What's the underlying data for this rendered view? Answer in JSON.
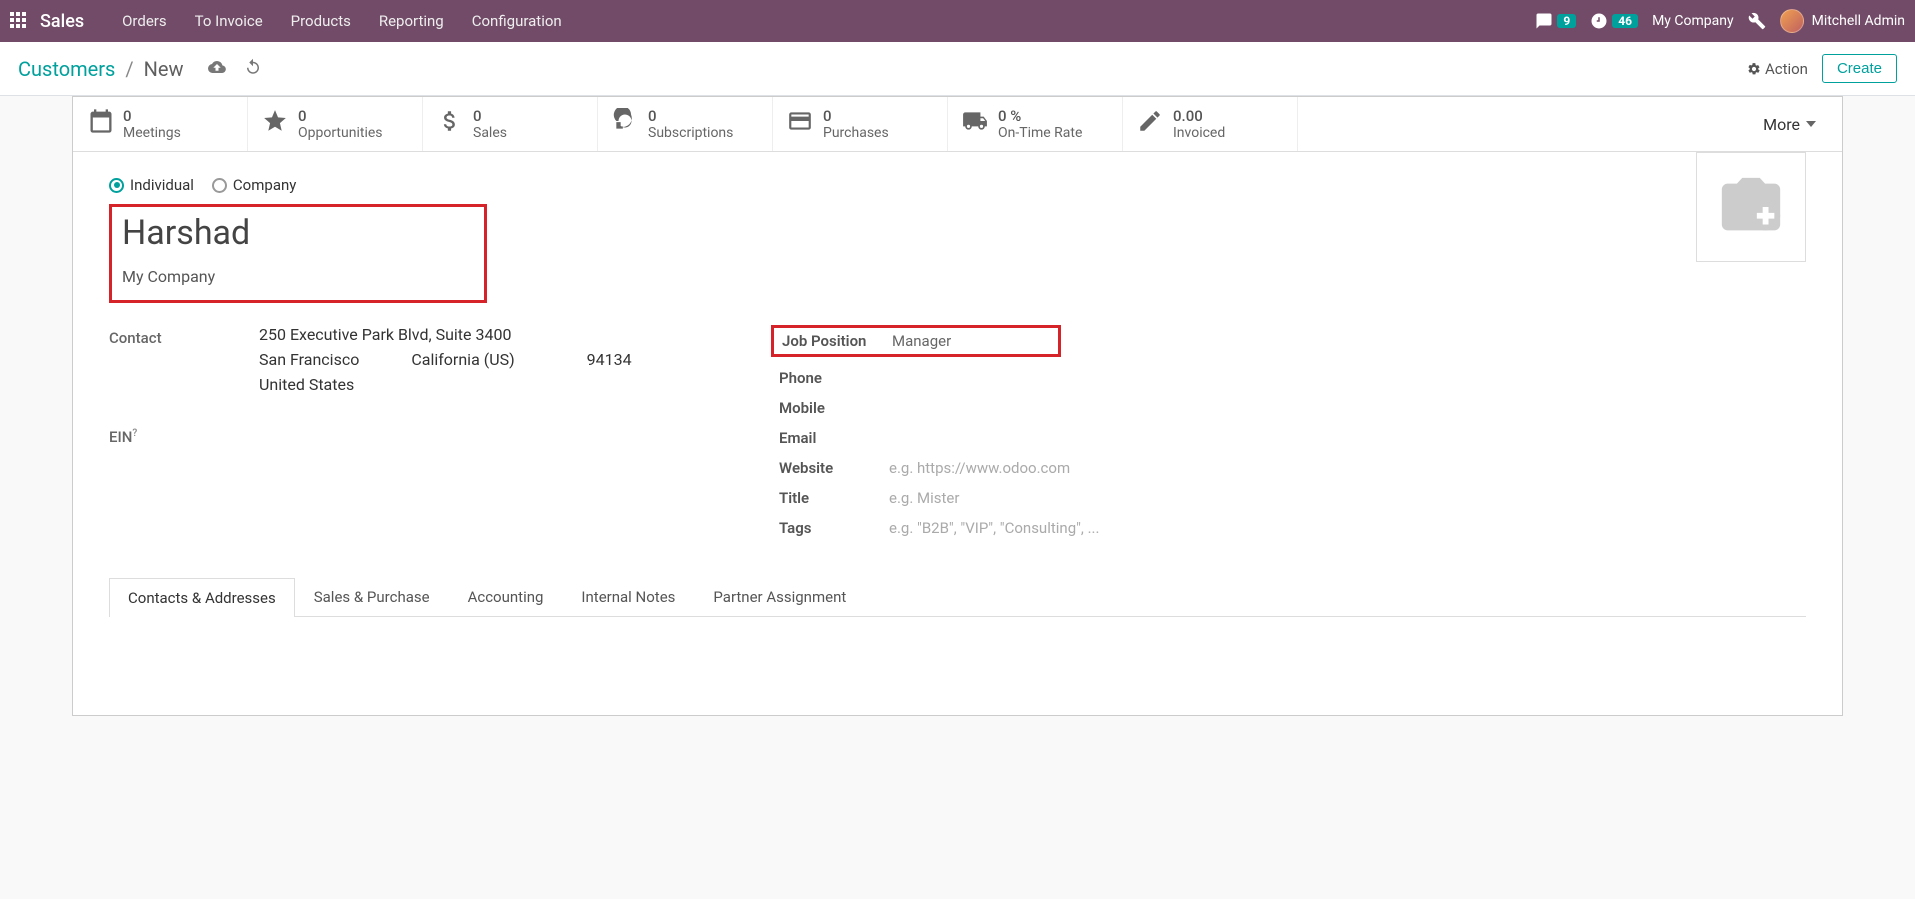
{
  "topbar": {
    "app": "Sales",
    "menu": [
      "Orders",
      "To Invoice",
      "Products",
      "Reporting",
      "Configuration"
    ],
    "msg_count": "9",
    "activity_count": "46",
    "company": "My Company",
    "user": "Mitchell Admin"
  },
  "breadcrumb": {
    "root": "Customers",
    "current": "New"
  },
  "controls": {
    "action": "Action",
    "create": "Create"
  },
  "stats": [
    {
      "value": "0",
      "label": "Meetings",
      "icon": "calendar"
    },
    {
      "value": "0",
      "label": "Opportunities",
      "icon": "star"
    },
    {
      "value": "0",
      "label": "Sales",
      "icon": "dollar"
    },
    {
      "value": "0",
      "label": "Subscriptions",
      "icon": "refresh"
    },
    {
      "value": "0",
      "label": "Purchases",
      "icon": "card"
    },
    {
      "value": "0 %",
      "label": "On-Time Rate",
      "icon": "truck"
    },
    {
      "value": "0.00",
      "label": "Invoiced",
      "icon": "edit"
    }
  ],
  "more": "More",
  "type_radio": {
    "individual": "Individual",
    "company": "Company"
  },
  "record": {
    "name": "Harshad",
    "company": "My Company"
  },
  "contact": {
    "label": "Contact",
    "street": "250 Executive Park Blvd, Suite 3400",
    "city": "San Francisco",
    "state": "California (US)",
    "zip": "94134",
    "country": "United States"
  },
  "ein_label": "EIN",
  "right_fields": {
    "job_position": {
      "label": "Job Position",
      "value": "Manager"
    },
    "phone": {
      "label": "Phone",
      "value": ""
    },
    "mobile": {
      "label": "Mobile",
      "value": ""
    },
    "email": {
      "label": "Email",
      "value": ""
    },
    "website": {
      "label": "Website",
      "placeholder": "e.g. https://www.odoo.com"
    },
    "title": {
      "label": "Title",
      "placeholder": "e.g. Mister"
    },
    "tags": {
      "label": "Tags",
      "placeholder": "e.g. \"B2B\", \"VIP\", \"Consulting\", ..."
    }
  },
  "tabs": [
    "Contacts & Addresses",
    "Sales & Purchase",
    "Accounting",
    "Internal Notes",
    "Partner Assignment"
  ]
}
